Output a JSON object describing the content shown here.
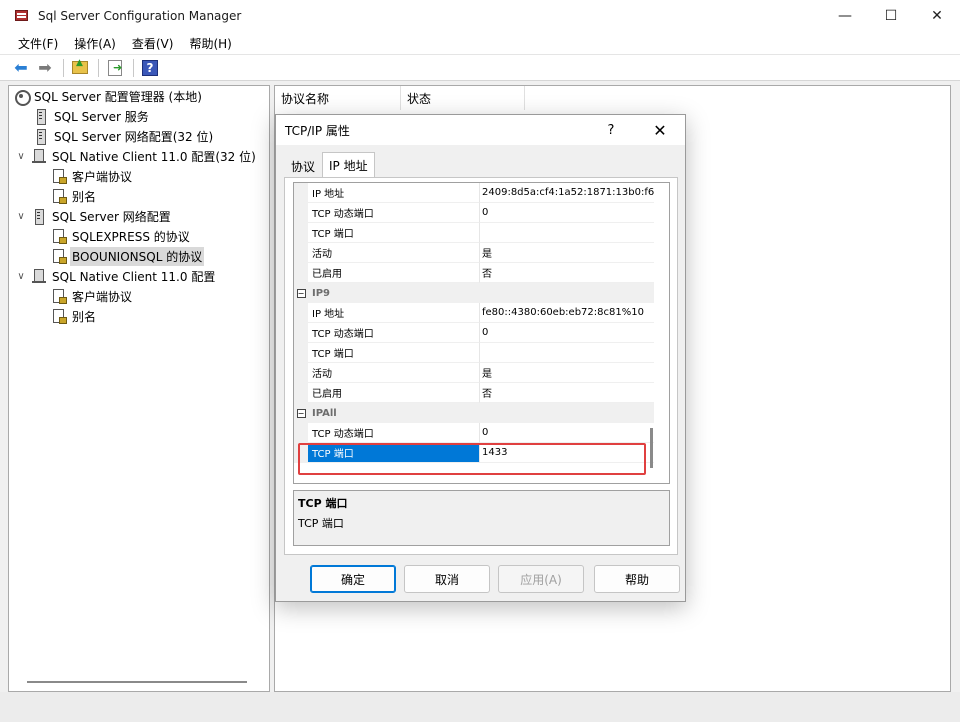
{
  "window": {
    "title": "Sql Server Configuration Manager",
    "controls": [
      "—",
      "☐",
      "✕"
    ]
  },
  "menu": [
    "文件(F)",
    "操作(A)",
    "查看(V)",
    "帮助(H)"
  ],
  "toolbar": {
    "icons": [
      "back-arrow-icon",
      "forward-arrow-icon",
      "up-folder-icon",
      "export-list-icon",
      "help-icon"
    ],
    "help_glyph": "?"
  },
  "tree": [
    {
      "label": "SQL Server 配置管理器 (本地)",
      "icon": "root-icon",
      "level": 0,
      "chevron": ""
    },
    {
      "label": "SQL Server 服务",
      "icon": "server-icon",
      "level": 1,
      "chevron": ""
    },
    {
      "label": "SQL Server 网络配置(32 位)",
      "icon": "server-icon",
      "level": 1,
      "chevron": ""
    },
    {
      "label": "SQL Native Client 11.0 配置(32 位)",
      "icon": "network-icon",
      "level": 1,
      "chevron": "∨"
    },
    {
      "label": "客户端协议",
      "icon": "protocol-icon",
      "level": 2,
      "chevron": ""
    },
    {
      "label": "别名",
      "icon": "protocol-icon",
      "level": 2,
      "chevron": ""
    },
    {
      "label": "SQL Server 网络配置",
      "icon": "server-icon",
      "level": 1,
      "chevron": "∨"
    },
    {
      "label": "SQLEXPRESS 的协议",
      "icon": "protocol-icon",
      "level": 2,
      "chevron": ""
    },
    {
      "label": "BOOUNIONSQL 的协议",
      "icon": "protocol-icon",
      "level": 2,
      "chevron": "",
      "selected": true
    },
    {
      "label": "SQL Native Client 11.0 配置",
      "icon": "network-icon",
      "level": 1,
      "chevron": "∨"
    },
    {
      "label": "客户端协议",
      "icon": "protocol-icon",
      "level": 2,
      "chevron": ""
    },
    {
      "label": "别名",
      "icon": "protocol-icon",
      "level": 2,
      "chevron": ""
    }
  ],
  "list_headers": [
    "协议名称",
    "状态"
  ],
  "dialog": {
    "title": "TCP/IP 属性",
    "help_glyph": "?",
    "close_glyph": "✕",
    "tabs": [
      "协议",
      "IP 地址"
    ],
    "active_tab": 1,
    "grid": [
      {
        "type": "prop",
        "name": "IP 地址",
        "value": "2409:8d5a:cf4:1a52:1871:13b0:f6"
      },
      {
        "type": "prop",
        "name": "TCP 动态端口",
        "value": "0"
      },
      {
        "type": "prop",
        "name": "TCP 端口",
        "value": ""
      },
      {
        "type": "prop",
        "name": "活动",
        "value": "是"
      },
      {
        "type": "prop",
        "name": "已启用",
        "value": "否"
      },
      {
        "type": "cat",
        "name": "IP9",
        "toggle": "−"
      },
      {
        "type": "prop",
        "name": "IP 地址",
        "value": "fe80::4380:60eb:eb72:8c81%10"
      },
      {
        "type": "prop",
        "name": "TCP 动态端口",
        "value": "0"
      },
      {
        "type": "prop",
        "name": "TCP 端口",
        "value": ""
      },
      {
        "type": "prop",
        "name": "活动",
        "value": "是"
      },
      {
        "type": "prop",
        "name": "已启用",
        "value": "否"
      },
      {
        "type": "cat",
        "name": "IPAll",
        "toggle": "−"
      },
      {
        "type": "prop",
        "name": "TCP 动态端口",
        "value": "0"
      },
      {
        "type": "prop",
        "name": "TCP 端口",
        "value": "1433",
        "selected": true
      }
    ],
    "description": {
      "title": "TCP 端口",
      "text": "TCP 端口"
    },
    "buttons": {
      "ok": "确定",
      "cancel": "取消",
      "apply": "应用(A)",
      "help": "帮助"
    }
  },
  "colors": {
    "selection": "#0078d7",
    "highlight_box": "#e04040"
  }
}
